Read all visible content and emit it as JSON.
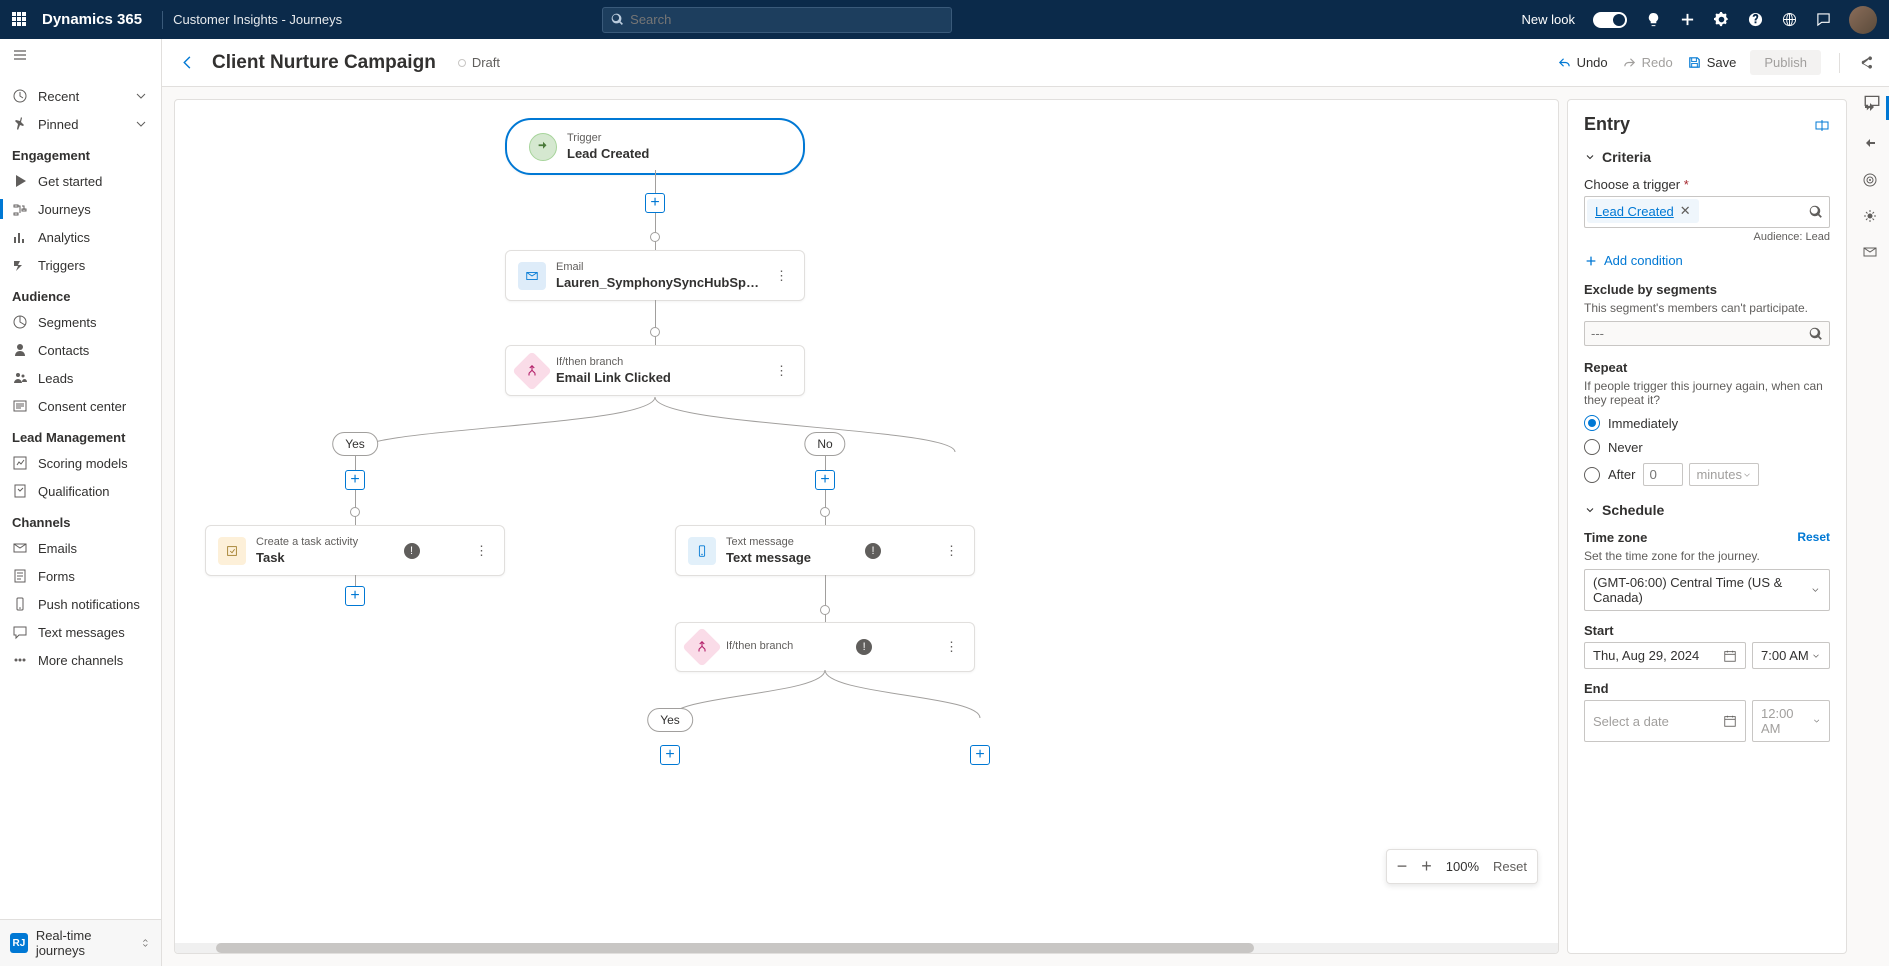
{
  "topbar": {
    "brand": "Dynamics 365",
    "app": "Customer Insights - Journeys",
    "search_placeholder": "Search",
    "newlook": "New look"
  },
  "sidebar": {
    "recent": "Recent",
    "pinned": "Pinned",
    "groups": {
      "engagement": "Engagement",
      "audience": "Audience",
      "lead": "Lead Management",
      "channels": "Channels"
    },
    "items": {
      "get_started": "Get started",
      "journeys": "Journeys",
      "analytics": "Analytics",
      "triggers": "Triggers",
      "segments": "Segments",
      "contacts": "Contacts",
      "leads": "Leads",
      "consent": "Consent center",
      "scoring": "Scoring models",
      "qualification": "Qualification",
      "emails": "Emails",
      "forms": "Forms",
      "push": "Push notifications",
      "text": "Text messages",
      "more": "More channels"
    },
    "bottom": {
      "badge": "RJ",
      "label": "Real-time journeys"
    }
  },
  "cmdbar": {
    "title": "Client Nurture Campaign",
    "status": "Draft",
    "undo": "Undo",
    "redo": "Redo",
    "save": "Save",
    "publish": "Publish"
  },
  "canvas": {
    "trigger": {
      "label": "Trigger",
      "title": "Lead Created"
    },
    "email": {
      "label": "Email",
      "title": "Lauren_SymphonySyncHubSpot_Market..."
    },
    "branch1": {
      "label": "If/then branch",
      "title": "Email Link Clicked"
    },
    "yes": "Yes",
    "no": "No",
    "task": {
      "label": "Create a task activity",
      "title": "Task"
    },
    "text": {
      "label": "Text message",
      "title": "Text message"
    },
    "branch2": {
      "label": "If/then branch",
      "title": ""
    },
    "zoom": "100%",
    "reset": "Reset"
  },
  "panel": {
    "title": "Entry",
    "criteria": "Criteria",
    "choose_trigger": "Choose a trigger",
    "trigger_value": "Lead Created",
    "audience": "Audience: Lead",
    "add_condition": "Add condition",
    "exclude": "Exclude by segments",
    "exclude_desc": "This segment's members can't participate.",
    "exclude_placeholder": "---",
    "repeat": "Repeat",
    "repeat_desc": "If people trigger this journey again, when can they repeat it?",
    "immediately": "Immediately",
    "never": "Never",
    "after": "After",
    "after_placeholder": "0",
    "after_unit": "minutes",
    "schedule": "Schedule",
    "timezone": "Time zone",
    "timezone_desc": "Set the time zone for the journey.",
    "timezone_reset": "Reset",
    "timezone_value": "(GMT-06:00) Central Time (US & Canada)",
    "start": "Start",
    "start_date": "Thu, Aug 29, 2024",
    "start_time": "7:00 AM",
    "end": "End",
    "end_date": "Select a date",
    "end_time": "12:00 AM"
  }
}
